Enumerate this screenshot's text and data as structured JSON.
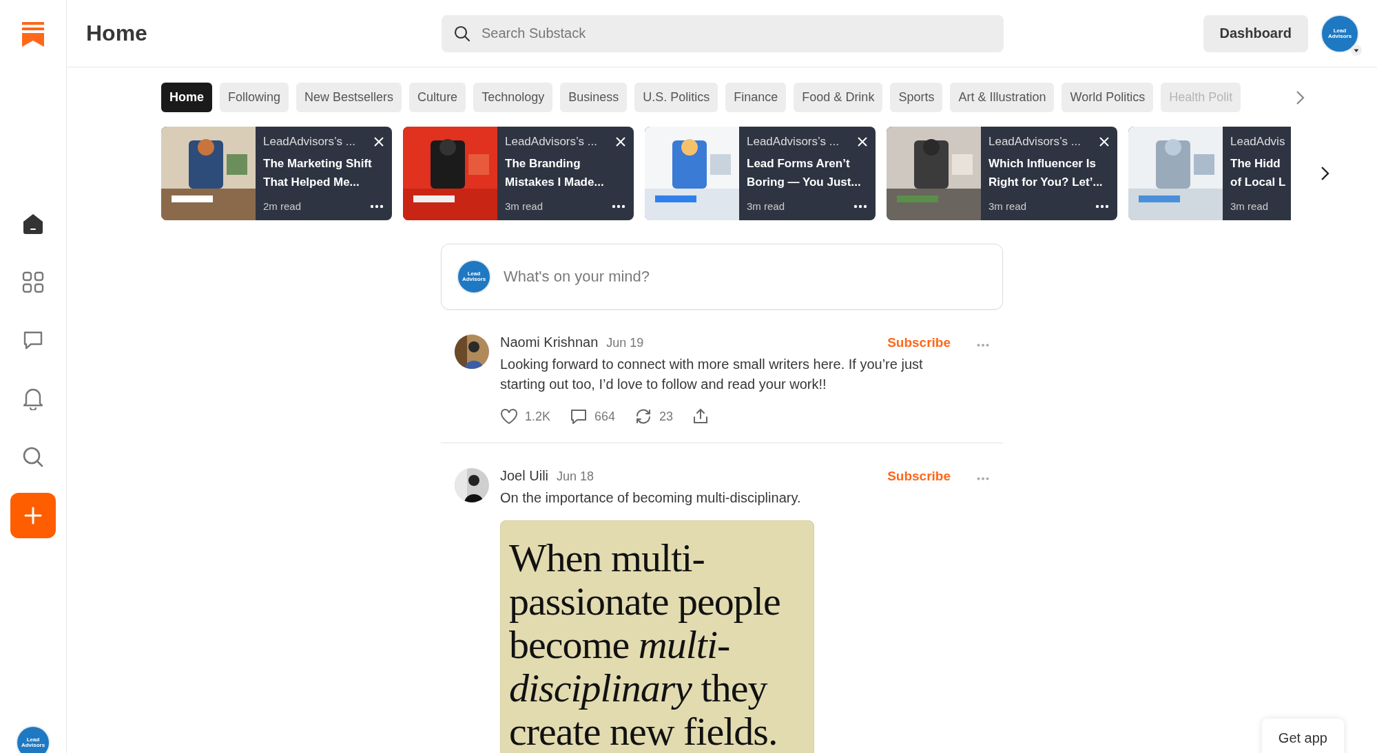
{
  "header": {
    "title": "Home",
    "search": {
      "placeholder": "Search Substack"
    },
    "dashboard": "Dashboard"
  },
  "account": {
    "top_avatar_lines": [
      "Lead",
      "Advisors"
    ],
    "composer_avatar_lines": [
      "Lead",
      "Advisors"
    ],
    "sidebar_avatar_lines": [
      "Lead",
      "Advisors"
    ]
  },
  "tabs": [
    {
      "label": "Home",
      "selected": true
    },
    {
      "label": "Following",
      "selected": false
    },
    {
      "label": "New Bestsellers",
      "selected": false
    },
    {
      "label": "Culture",
      "selected": false
    },
    {
      "label": "Technology",
      "selected": false
    },
    {
      "label": "Business",
      "selected": false
    },
    {
      "label": "U.S. Politics",
      "selected": false
    },
    {
      "label": "Finance",
      "selected": false
    },
    {
      "label": "Food & Drink",
      "selected": false
    },
    {
      "label": "Sports",
      "selected": false
    },
    {
      "label": "Art & Illustration",
      "selected": false
    },
    {
      "label": "World Politics",
      "selected": false
    },
    {
      "label": "Health Polit",
      "selected": false
    }
  ],
  "cards": [
    {
      "publication": "LeadAdvisors’s ...",
      "title_lines": [
        "The Marketing Shift",
        "That Helped Me..."
      ],
      "read_time": "2m read"
    },
    {
      "publication": "LeadAdvisors’s ...",
      "title_lines": [
        "The Branding",
        "Mistakes I Made..."
      ],
      "read_time": "3m read"
    },
    {
      "publication": "LeadAdvisors’s ...",
      "title_lines": [
        "Lead Forms Aren’t",
        "Boring — You Just..."
      ],
      "read_time": "3m read"
    },
    {
      "publication": "LeadAdvisors’s ...",
      "title_lines": [
        "Which Influencer Is",
        "Right for You? Let’..."
      ],
      "read_time": "3m read"
    },
    {
      "publication": "LeadAdvis",
      "title_lines": [
        "The Hidd",
        "of Local L"
      ],
      "read_time": "3m read"
    }
  ],
  "composer": {
    "placeholder": "What's on your mind?"
  },
  "posts": [
    {
      "author": "Naomi Krishnan",
      "date": "Jun 19",
      "subscribe": "Subscribe",
      "text": "Looking forward to connect with more small writers here. If you’re just starting out too, I’d love to follow and read your work!!",
      "likes": "1.2K",
      "comments": "664",
      "restacks": "23"
    },
    {
      "author": "Joel Uili",
      "date": "Jun 18",
      "subscribe": "Subscribe",
      "text": "On the importance of becoming multi-disciplinary.",
      "quote": "When multi-passionate people become *multi-disciplinary* they create new fields."
    }
  ],
  "get_app": "Get app"
}
